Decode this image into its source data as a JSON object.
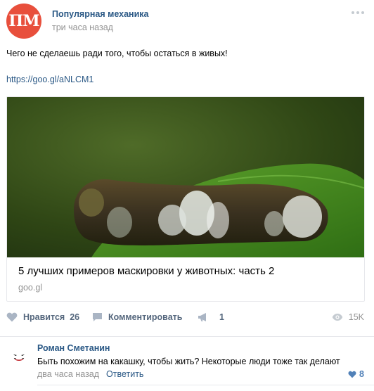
{
  "post": {
    "avatar_text": "ПМ",
    "author": "Популярная механика",
    "time": "три часа назад",
    "text": "Чего не сделаешь ради того, чтобы остаться в живых!",
    "link": "https://goo.gl/aNLCM1",
    "card": {
      "title": "5 лучших примеров маскировки у животных: часть 2",
      "domain": "goo.gl"
    }
  },
  "actions": {
    "like_label": "Нравится",
    "like_count": "26",
    "comment_label": "Комментировать",
    "share_count": "1",
    "views": "15K"
  },
  "comment": {
    "author": "Роман Сметанин",
    "text": "Быть похожим на какашку, чтобы жить? Некоторые люди тоже так делают",
    "time": "два часа назад",
    "reply_label": "Ответить",
    "likes": "8"
  },
  "colors": {
    "link": "#2a5885",
    "avatar": "#e84f3c",
    "muted": "#939393",
    "action": "#55677d"
  },
  "icons": [
    "more-icon",
    "heart-icon",
    "comment-icon",
    "megaphone-icon",
    "eye-icon",
    "joker-avatar-icon"
  ]
}
